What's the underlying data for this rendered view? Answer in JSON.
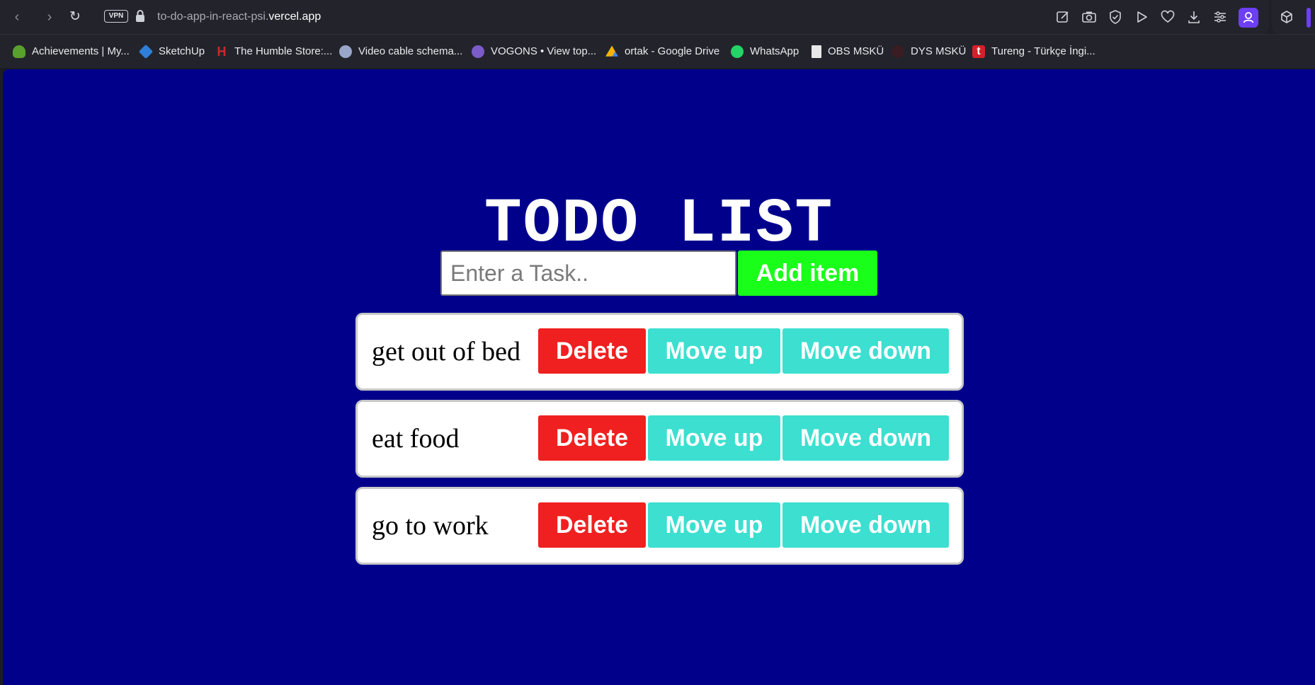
{
  "browser": {
    "vpn_label": "VPN",
    "url_prefix": "to-do-app-in-react-psi.",
    "url_domain": "vercel.app",
    "accent_color": "#6d3ff7"
  },
  "bookmarks": [
    {
      "label": "Achievements | My...",
      "icon": "turtle-icon",
      "color": "#5aa02c"
    },
    {
      "label": "SketchUp",
      "icon": "sketchup-icon",
      "color": "#2f7fd8"
    },
    {
      "label": "The Humble Store:...",
      "icon": "humble-icon",
      "color": "#cc2929"
    },
    {
      "label": "Video cable schema...",
      "icon": "globe-icon",
      "color": "#9aa6c9"
    },
    {
      "label": "VOGONS • View top...",
      "icon": "vogons-icon",
      "color": "#7b5cc8"
    },
    {
      "label": "ortak - Google Drive",
      "icon": "google-drive-icon",
      "color": "#f4b400"
    },
    {
      "label": "WhatsApp",
      "icon": "whatsapp-icon",
      "color": "#25d366"
    },
    {
      "label": "OBS MSKÜ",
      "icon": "document-icon",
      "color": "#e8e8e8"
    },
    {
      "label": "DYS MSKÜ",
      "icon": "dys-icon",
      "color": "#3a1c22"
    },
    {
      "label": "Tureng - Türkçe İngi...",
      "icon": "tureng-icon",
      "color": "#d4202a"
    }
  ],
  "app": {
    "title": "TODO LIST",
    "input_placeholder": "Enter a Task..",
    "input_value": "",
    "add_label": "Add item",
    "background_color": "#00008b",
    "add_color": "#1aff1a",
    "delete_color": "#f02020",
    "move_color": "#3cdfd0",
    "todos": [
      {
        "text": "get out of bed",
        "delete_label": "Delete",
        "up_label": "Move up",
        "down_label": "Move down"
      },
      {
        "text": "eat food",
        "delete_label": "Delete",
        "up_label": "Move up",
        "down_label": "Move down"
      },
      {
        "text": "go to work",
        "delete_label": "Delete",
        "up_label": "Move up",
        "down_label": "Move down"
      }
    ]
  }
}
